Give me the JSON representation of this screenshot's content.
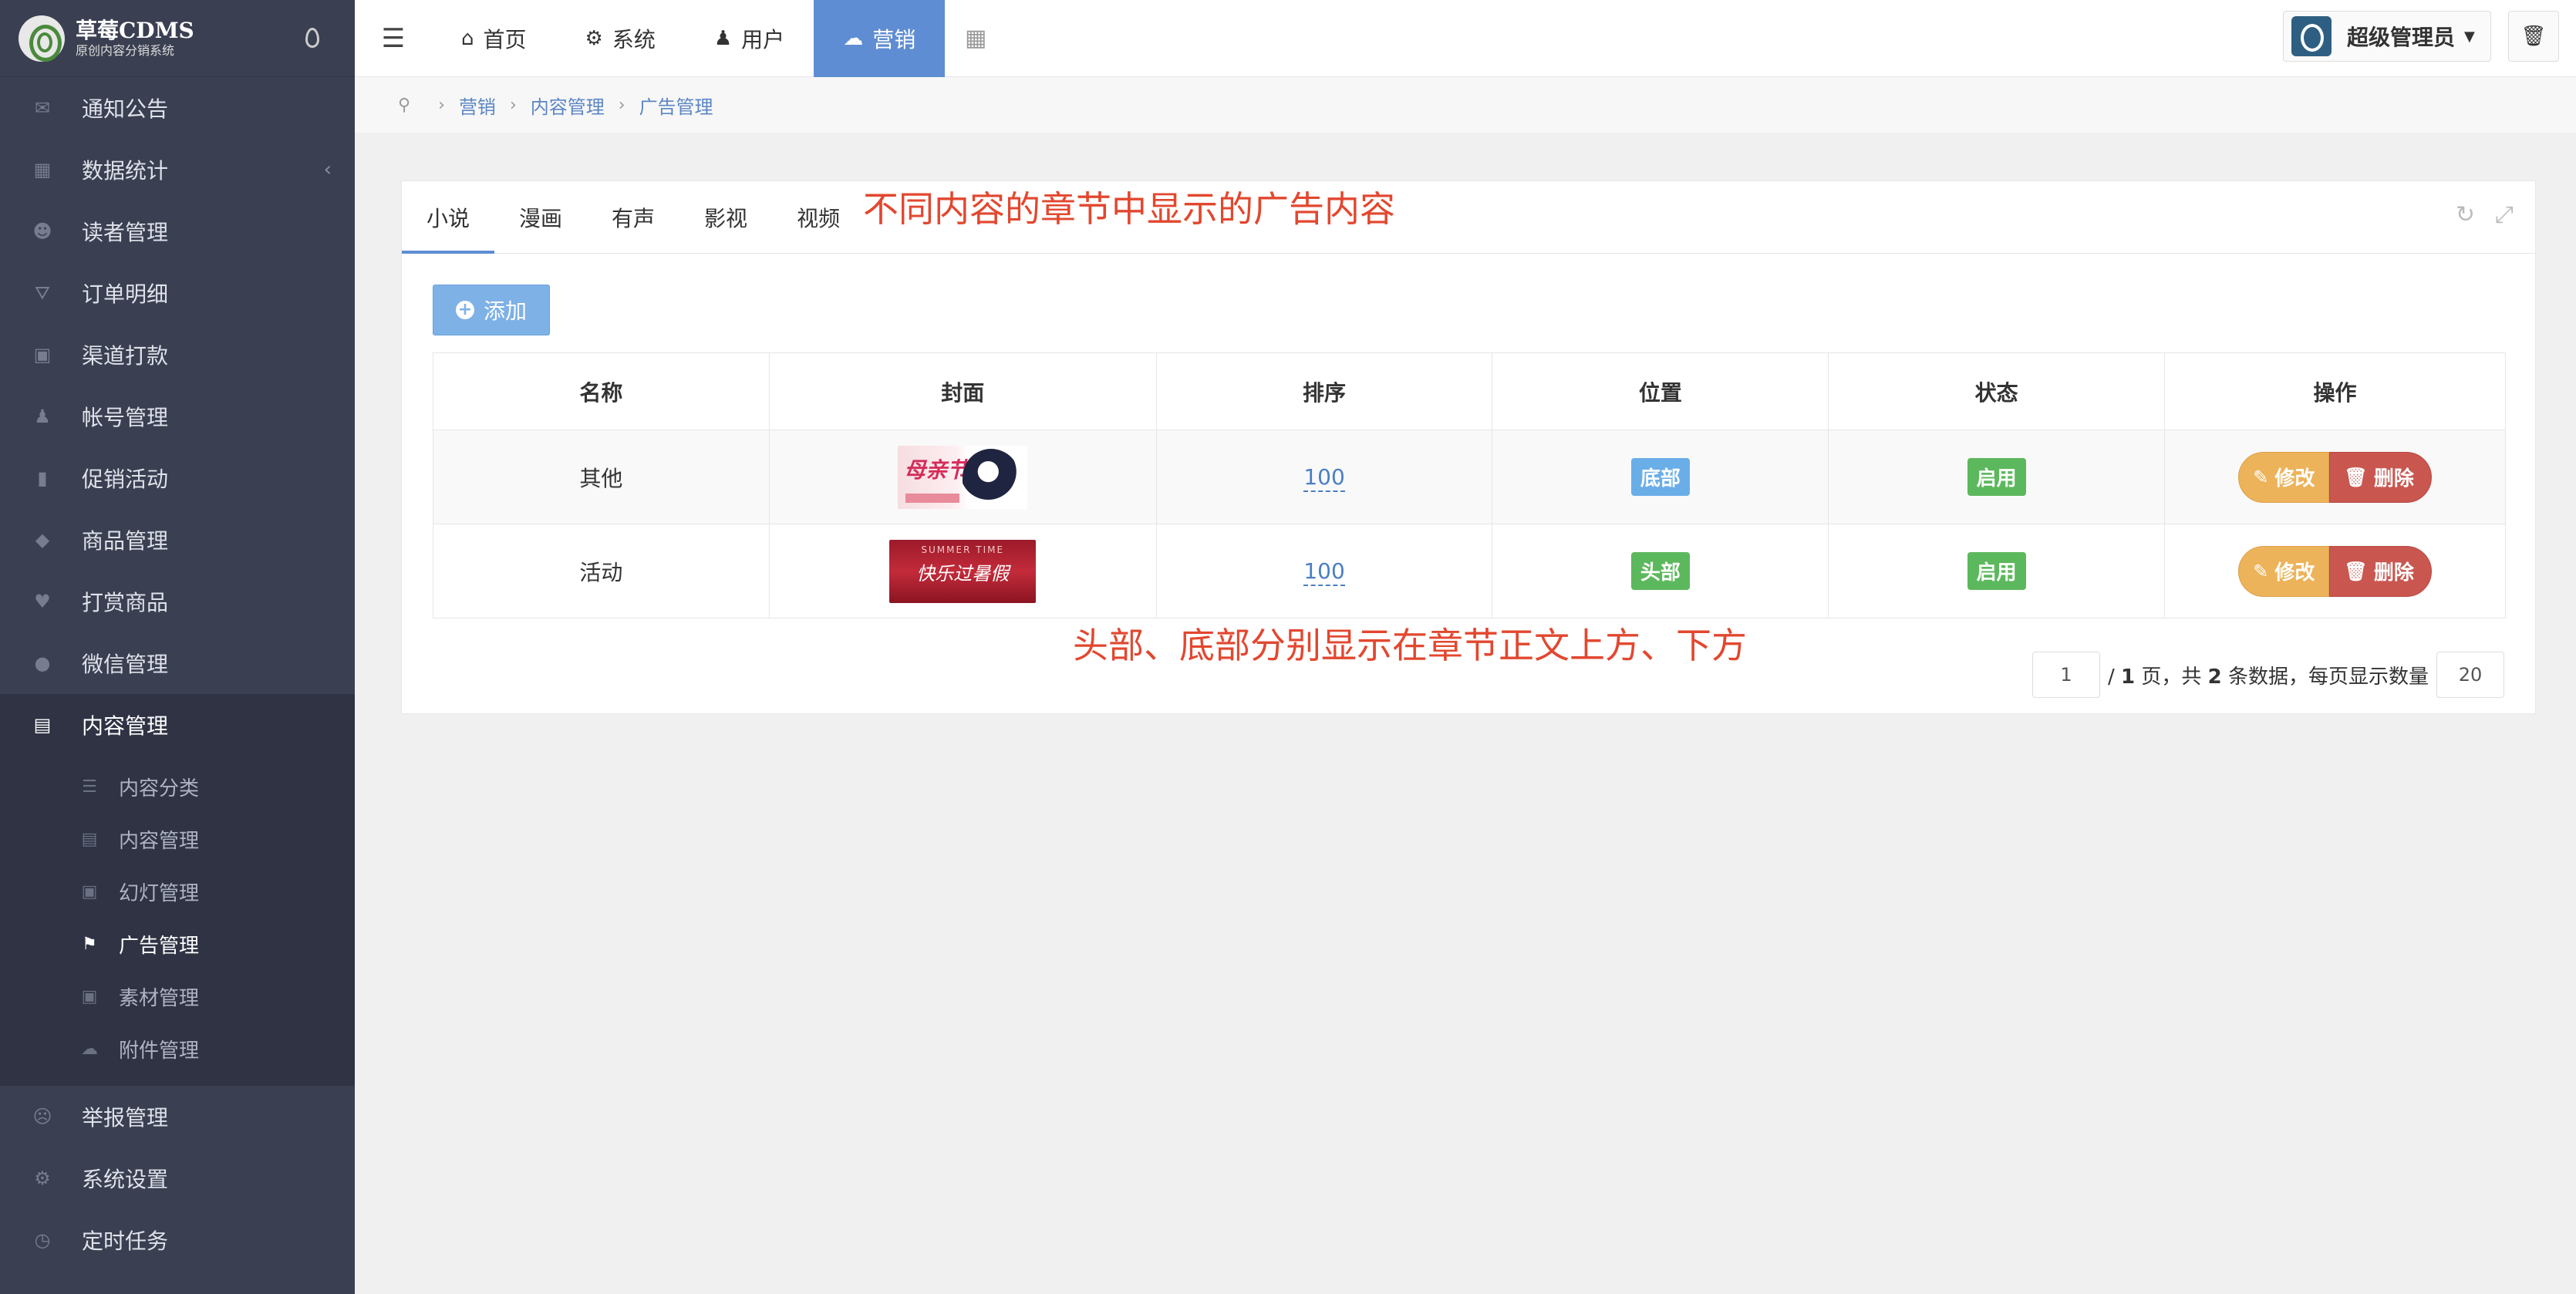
{
  "brand": {
    "title": "草莓CDMS",
    "subtitle": "原创内容分销系统"
  },
  "sidebar": {
    "items": [
      {
        "label": "通知公告",
        "icon": "comment-icon"
      },
      {
        "label": "数据统计",
        "icon": "bar-chart-icon"
      },
      {
        "label": "读者管理",
        "icon": "user-secret-icon"
      },
      {
        "label": "订单明细",
        "icon": "cart-icon"
      },
      {
        "label": "渠道打款",
        "icon": "credit-card-icon"
      },
      {
        "label": "帐号管理",
        "icon": "user-icon"
      },
      {
        "label": "促销活动",
        "icon": "shopping-bag-icon"
      },
      {
        "label": "商品管理",
        "icon": "diamond-icon"
      },
      {
        "label": "打赏商品",
        "icon": "heart-icon"
      },
      {
        "label": "微信管理",
        "icon": "wechat-icon"
      },
      {
        "label": "内容管理",
        "icon": "book-icon"
      }
    ],
    "sub_items": [
      {
        "label": "内容分类"
      },
      {
        "label": "内容管理"
      },
      {
        "label": "幻灯管理"
      },
      {
        "label": "广告管理"
      },
      {
        "label": "素材管理"
      },
      {
        "label": "附件管理"
      }
    ],
    "bottom_items": [
      {
        "label": "举报管理"
      },
      {
        "label": "系统设置"
      },
      {
        "label": "定时任务"
      }
    ]
  },
  "topnav": {
    "tabs": [
      {
        "label": "首页"
      },
      {
        "label": "系统"
      },
      {
        "label": "用户"
      },
      {
        "label": "营销"
      }
    ],
    "user": "超级管理员"
  },
  "breadcrumb": {
    "items": [
      "营销",
      "内容管理",
      "广告管理"
    ]
  },
  "panel": {
    "tabs": [
      "小说",
      "漫画",
      "有声",
      "影视",
      "视频"
    ],
    "annotation_tabs": "不同内容的章节中显示的广告内容",
    "annotation_table": "头部、底部分别显示在章节正文上方、下方",
    "add_label": "添加",
    "columns": [
      "名称",
      "封面",
      "排序",
      "位置",
      "状态",
      "操作"
    ],
    "rows": [
      {
        "name": "其他",
        "cover_text": "母亲节",
        "sort": "100",
        "position": "底部",
        "status": "启用"
      },
      {
        "name": "活动",
        "cover_text": "快乐过暑假",
        "cover_top": "SUMMER TIME",
        "sort": "100",
        "position": "头部",
        "status": "启用"
      }
    ],
    "edit_label": "修改",
    "delete_label": "删除",
    "pager": {
      "page": "1",
      "total_pages": "1",
      "page_suffix": "页，共",
      "total_items": "2",
      "items_suffix": "条数据，每页显示数量",
      "per_page": "20"
    }
  },
  "colors": {
    "sidebar_bg": "#3a3f51",
    "accent": "#5f8dd3",
    "annotation": "#e2472f",
    "edit": "#edb35a",
    "delete": "#c9574f"
  }
}
